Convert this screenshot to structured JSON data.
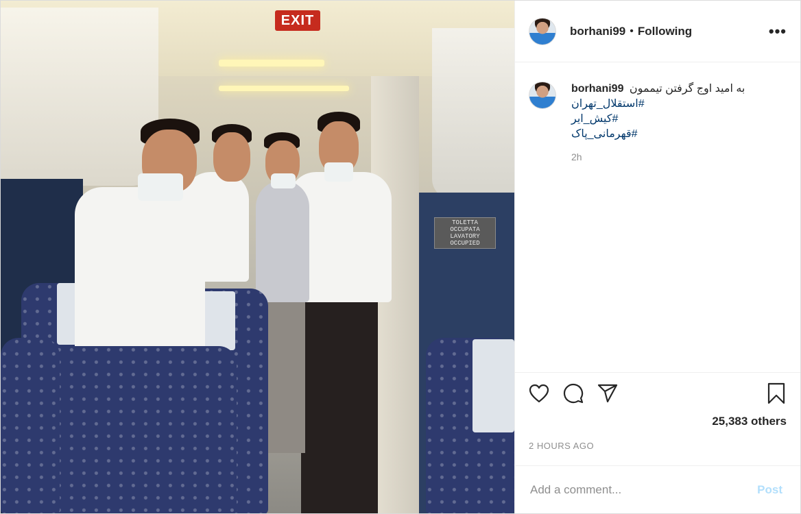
{
  "photo": {
    "exit_sign": "EXIT",
    "lavatory_sign": [
      "TOLETTA",
      "OCCUPATA",
      "LAVATORY",
      "OCCUPIED"
    ]
  },
  "header": {
    "username": "borhani99",
    "separator": "•",
    "follow_status": "Following",
    "more_icon": "ellipsis-icon",
    "more_label": "•••"
  },
  "caption": {
    "username": "borhani99",
    "text": "به امید اوج گرفتن تیممون",
    "hashtags": [
      "#استقلال_تهران",
      "#کیش_ایر",
      "#قهرمانی_پاک"
    ],
    "time": "2h"
  },
  "actions": {
    "like_icon": "heart-icon",
    "comment_icon": "comment-bubble-icon",
    "share_icon": "paper-plane-icon",
    "save_icon": "bookmark-icon"
  },
  "likes": {
    "text": "25,383 others"
  },
  "timestamp": "2 HOURS AGO",
  "comment_box": {
    "placeholder": "Add a comment...",
    "post_label": "Post"
  },
  "colors": {
    "link": "#00376b",
    "muted": "#8e8e8e",
    "post_disabled": "#b2dffc",
    "exit_red": "#c62b1e"
  }
}
